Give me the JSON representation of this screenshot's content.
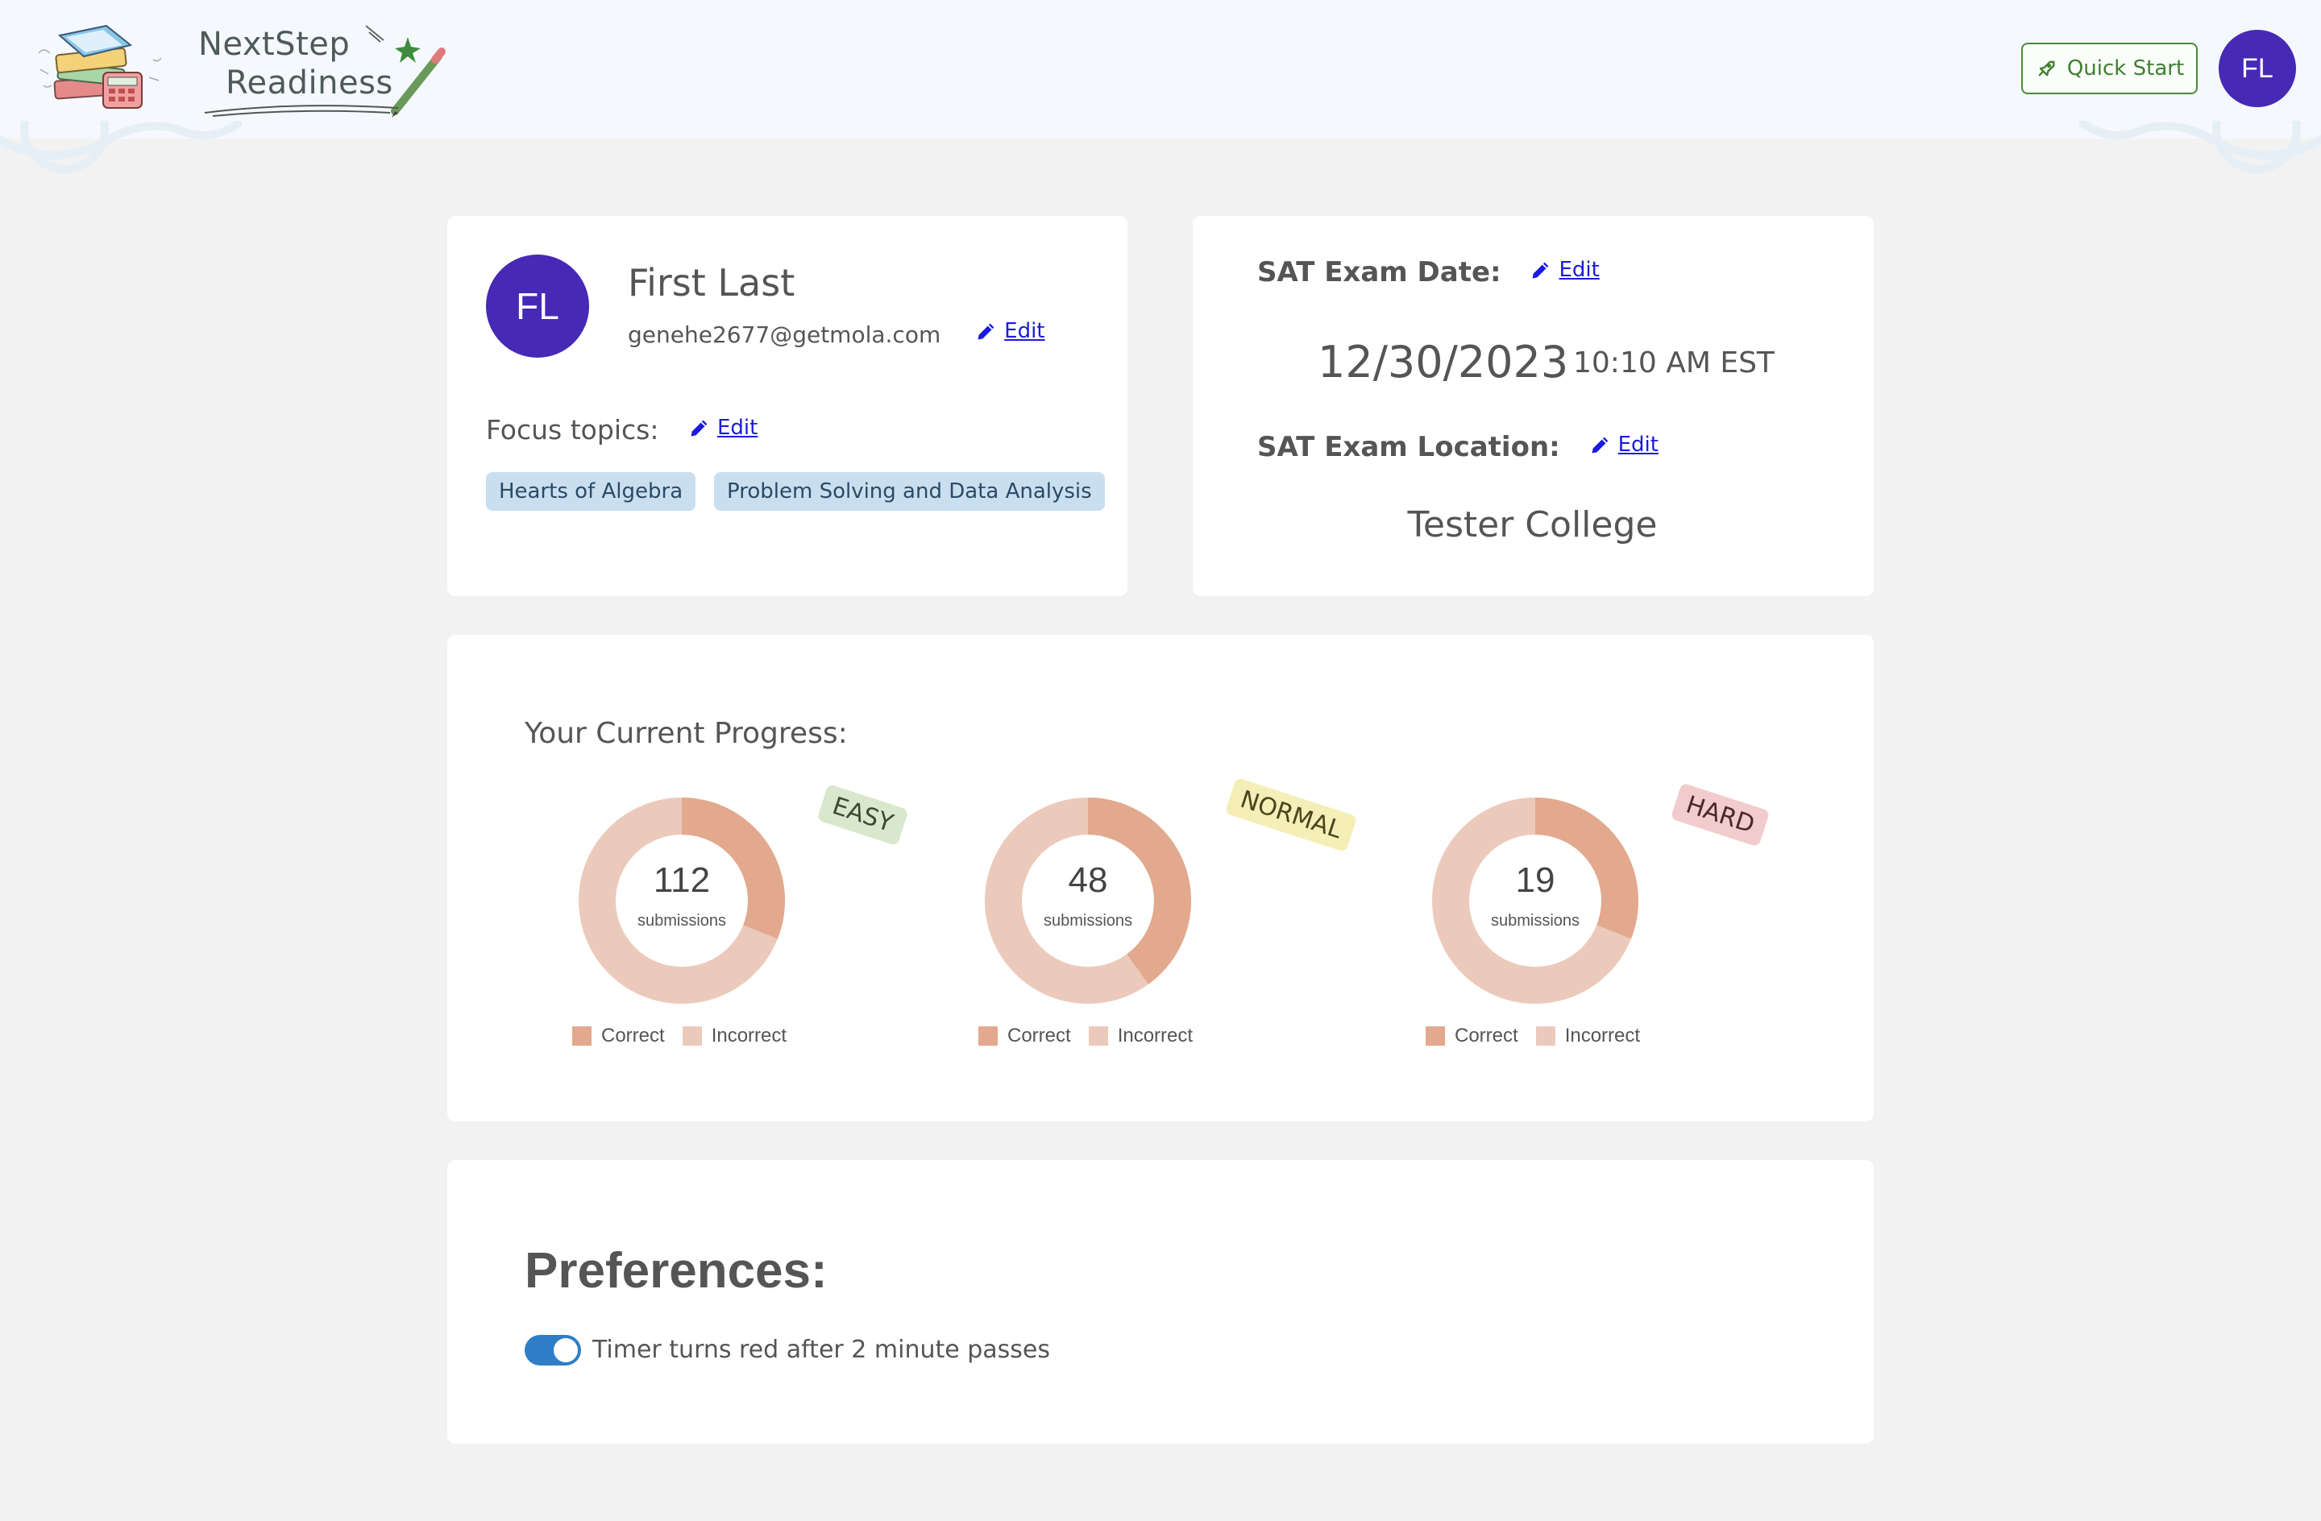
{
  "header": {
    "logo": {
      "line1": "NextStep",
      "line2": "Readiness"
    },
    "quick_start_label": "Quick Start",
    "avatar_initials": "FL"
  },
  "profile": {
    "avatar_initials": "FL",
    "name": "First Last",
    "email": "genehe2677@getmola.com",
    "edit_label": "Edit",
    "focus_label": "Focus topics:",
    "focus_edit_label": "Edit",
    "topics": [
      "Hearts of Algebra",
      "Problem Solving and Data Analysis"
    ]
  },
  "exam": {
    "date_label": "SAT Exam Date:",
    "date_edit_label": "Edit",
    "date": "12/30/2023",
    "time": "10:10 AM EST",
    "location_label": "SAT Exam Location:",
    "location_edit_label": "Edit",
    "location": "Tester College"
  },
  "progress": {
    "title": "Your Current Progress:",
    "colors": {
      "correct": "#e2a98e",
      "incorrect": "#eccabb"
    },
    "legend": {
      "correct": "Correct",
      "incorrect": "Incorrect"
    },
    "sub_label": "submissions",
    "difficulties": [
      {
        "tag": "EASY",
        "count": "112",
        "correct_fraction": 0.31,
        "tag_bg": "#d7e8cc",
        "tag_color": "#3b4a32"
      },
      {
        "tag": "NORMAL",
        "count": "48",
        "correct_fraction": 0.4,
        "tag_bg": "#f5efb7",
        "tag_color": "#4a4520"
      },
      {
        "tag": "HARD",
        "count": "19",
        "correct_fraction": 0.31,
        "tag_bg": "#f2cccc",
        "tag_color": "#4a2828"
      }
    ]
  },
  "preferences": {
    "title": "Preferences:",
    "timer_label": "Timer turns red after 2 minute passes",
    "timer_enabled": true
  }
}
